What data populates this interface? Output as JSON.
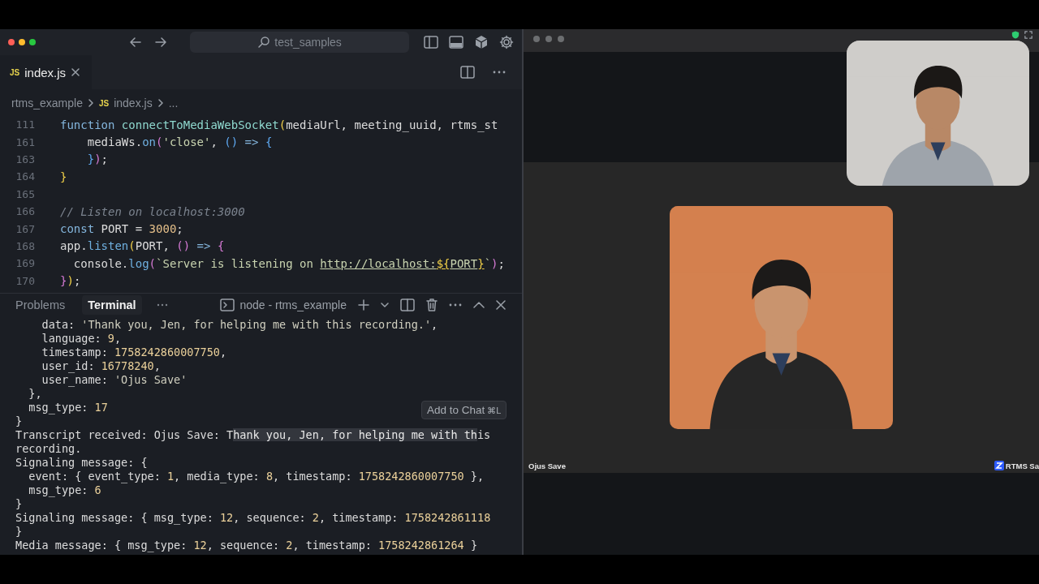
{
  "editor": {
    "search": "test_samples",
    "tabs": [
      {
        "icon": "JS",
        "label": "index.js",
        "selected": true
      }
    ],
    "breadcrumb": [
      {
        "text": "rtms_example"
      },
      {
        "icon": "JS",
        "text": "index.js"
      },
      {
        "text": "..."
      }
    ],
    "code_lines": [
      {
        "number": "111",
        "segments": [
          {
            "text": "function ",
            "kind": "keyword"
          },
          {
            "text": "connectToMediaWebSocket",
            "kind": "function"
          },
          {
            "text": "(",
            "kind": "bracket1"
          },
          {
            "text": "mediaUrl, meeting_uuid, rtms_st",
            "kind": "plain"
          }
        ]
      },
      {
        "number": "161",
        "segments": [
          {
            "text": "    mediaWs.",
            "kind": "plain"
          },
          {
            "text": "on",
            "kind": "method"
          },
          {
            "text": "(",
            "kind": "bracket2"
          },
          {
            "text": "'close'",
            "kind": "string"
          },
          {
            "text": ", ",
            "kind": "plain"
          },
          {
            "text": "()",
            "kind": "bracket3"
          },
          {
            "text": " => ",
            "kind": "keyword"
          },
          {
            "text": "{",
            "kind": "bracket3"
          }
        ]
      },
      {
        "number": "163",
        "segments": [
          {
            "text": "    }",
            "kind": "bracket3"
          },
          {
            "text": ")",
            "kind": "bracket2"
          },
          {
            "text": ";",
            "kind": "plain"
          }
        ]
      },
      {
        "number": "164",
        "segments": [
          {
            "text": "}",
            "kind": "bracket1"
          }
        ]
      },
      {
        "number": "165"
      },
      {
        "number": "166",
        "segments": [
          {
            "text": "// Listen on localhost:3000",
            "kind": "comment"
          }
        ]
      },
      {
        "number": "167",
        "segments": [
          {
            "text": "const",
            "kind": "keyword"
          },
          {
            "text": " PORT = ",
            "kind": "plain"
          },
          {
            "text": "3000",
            "kind": "number"
          },
          {
            "text": ";",
            "kind": "plain"
          }
        ]
      },
      {
        "number": "168",
        "segments": [
          {
            "text": "app.",
            "kind": "plain"
          },
          {
            "text": "listen",
            "kind": "method"
          },
          {
            "text": "(",
            "kind": "bracket1"
          },
          {
            "text": "PORT, ",
            "kind": "plain"
          },
          {
            "text": "()",
            "kind": "bracket2"
          },
          {
            "text": " => ",
            "kind": "keyword"
          },
          {
            "text": "{",
            "kind": "bracket2"
          }
        ]
      },
      {
        "number": "169",
        "segments": [
          {
            "text": "  console.",
            "kind": "plain"
          },
          {
            "text": "log",
            "kind": "method"
          },
          {
            "text": "(",
            "kind": "bracket2"
          },
          {
            "text": "`Server is listening on ",
            "kind": "string"
          },
          {
            "text": "http://localhost:",
            "kind": "url"
          },
          {
            "text": "${",
            "kind": "url-template"
          },
          {
            "text": "PORT",
            "kind": "url"
          },
          {
            "text": "}",
            "kind": "url-template"
          },
          {
            "text": "`",
            "kind": "string"
          },
          {
            "text": ")",
            "kind": "bracket2"
          },
          {
            "text": ";",
            "kind": "plain"
          }
        ]
      },
      {
        "number": "170",
        "segments": [
          {
            "text": "}",
            "kind": "bracket2"
          },
          {
            "text": ")",
            "kind": "bracket1"
          },
          {
            "text": ";",
            "kind": "plain"
          }
        ]
      }
    ]
  },
  "panel": {
    "tabs": [
      {
        "label": "Problems",
        "selected": false
      },
      {
        "label": "Terminal",
        "selected": true
      }
    ],
    "terminal_name": "node - rtms_example",
    "lines": [
      [
        {
          "text": "    data: ",
          "kind": "plain"
        },
        {
          "text": "'Thank you, Jen, for helping me with this recording.'",
          "kind": "string"
        },
        {
          "text": ",",
          "kind": "plain"
        }
      ],
      [
        {
          "text": "    language: ",
          "kind": "plain"
        },
        {
          "text": "9",
          "kind": "number"
        },
        {
          "text": ",",
          "kind": "plain"
        }
      ],
      [
        {
          "text": "    timestamp: ",
          "kind": "plain"
        },
        {
          "text": "1758242860007750",
          "kind": "number"
        },
        {
          "text": ",",
          "kind": "plain"
        }
      ],
      [
        {
          "text": "    user_id: ",
          "kind": "plain"
        },
        {
          "text": "16778240",
          "kind": "number"
        },
        {
          "text": ",",
          "kind": "plain"
        }
      ],
      [
        {
          "text": "    user_name: ",
          "kind": "plain"
        },
        {
          "text": "'Ojus Save'",
          "kind": "string"
        }
      ],
      [
        {
          "text": "  },",
          "kind": "plain"
        }
      ],
      [
        {
          "text": "  msg_type: ",
          "kind": "plain"
        },
        {
          "text": "17",
          "kind": "number"
        }
      ],
      [
        {
          "text": "}",
          "kind": "plain"
        }
      ],
      [
        {
          "text": "Transcript received: Ojus Save: T",
          "kind": "plain"
        },
        {
          "text": "hank you, Jen, for helping me with th",
          "kind": "selected"
        },
        {
          "text": "is",
          "kind": "plain"
        }
      ],
      [
        {
          "text": "recording.",
          "kind": "plain"
        }
      ],
      [
        {
          "text": "Signaling message: {",
          "kind": "plain"
        }
      ],
      [
        {
          "text": "  event: { event_type: ",
          "kind": "plain"
        },
        {
          "text": "1",
          "kind": "number"
        },
        {
          "text": ", media_type: ",
          "kind": "plain"
        },
        {
          "text": "8",
          "kind": "number"
        },
        {
          "text": ", timestamp: ",
          "kind": "plain"
        },
        {
          "text": "1758242860007750",
          "kind": "number"
        },
        {
          "text": " },",
          "kind": "plain"
        }
      ],
      [
        {
          "text": "  msg_type: ",
          "kind": "plain"
        },
        {
          "text": "6",
          "kind": "number"
        }
      ],
      [
        {
          "text": "}",
          "kind": "plain"
        }
      ],
      [
        {
          "text": "Signaling message: { msg_type: ",
          "kind": "plain"
        },
        {
          "text": "12",
          "kind": "number"
        },
        {
          "text": ", sequence: ",
          "kind": "plain"
        },
        {
          "text": "2",
          "kind": "number"
        },
        {
          "text": ", timestamp: ",
          "kind": "plain"
        },
        {
          "text": "1758242861118",
          "kind": "number"
        }
      ],
      [
        {
          "text": "}",
          "kind": "plain"
        }
      ],
      [
        {
          "text": "Media message: { msg_type: ",
          "kind": "plain"
        },
        {
          "text": "12",
          "kind": "number"
        },
        {
          "text": ", sequence: ",
          "kind": "plain"
        },
        {
          "text": "2",
          "kind": "number"
        },
        {
          "text": ", timestamp: ",
          "kind": "plain"
        },
        {
          "text": "1758242861264",
          "kind": "number"
        },
        {
          "text": " }",
          "kind": "plain"
        }
      ]
    ],
    "tooltip": {
      "label": "Add to Chat",
      "shortcut": "⌘L"
    }
  },
  "meeting": {
    "speaker": {
      "kind": "picture",
      "name": "Ojus Save"
    },
    "meeting_label": "RTMS Sa"
  }
}
